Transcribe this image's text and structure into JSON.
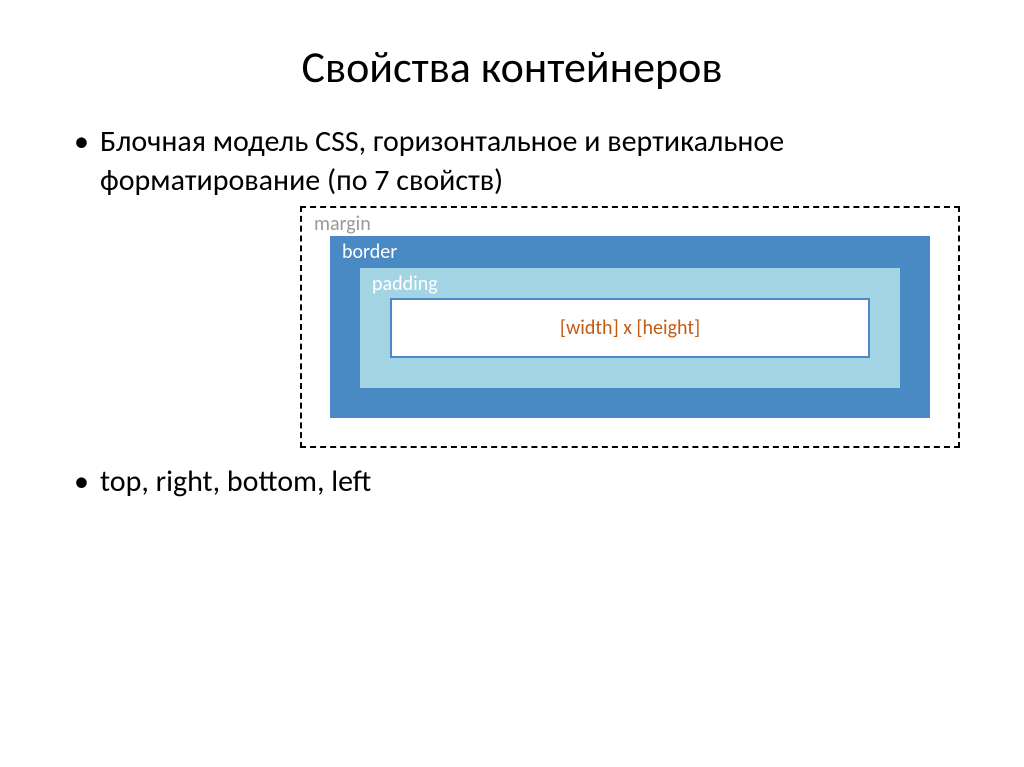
{
  "title": "Свойства контейнеров",
  "bullets": {
    "first": "Блочная модель CSS, горизонтальное и вертикальное форматирование (по 7 свойств)",
    "second": "top, right, bottom, left"
  },
  "diagram": {
    "margin_label": "margin",
    "border_label": "border",
    "padding_label": "padding",
    "content_label": "[width] x [height]"
  }
}
